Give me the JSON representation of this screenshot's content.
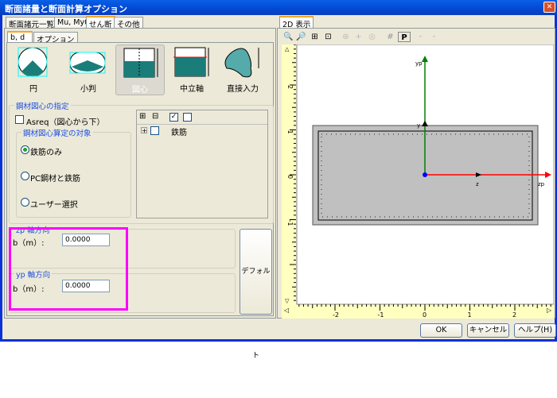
{
  "title": "断面諸量と断面計算オプション",
  "tabs": [
    "断面諸元一覧",
    "Mu, My0",
    "せん断",
    "その他"
  ],
  "subtabs": [
    "b, d",
    "オプション"
  ],
  "shape_buttons": [
    {
      "label": "円"
    },
    {
      "label": "小判"
    },
    {
      "label": "図心",
      "selected": true
    },
    {
      "label": "中立軸"
    },
    {
      "label": "直接入力"
    }
  ],
  "steel_group": {
    "title": "鋼材図心の指定",
    "asreq_label": "Asreq（図心から下）",
    "asreq_checked": false,
    "target_group": {
      "title": "鋼材図心算定の対象",
      "options": [
        "鉄筋のみ",
        "PC鋼材と鉄筋",
        "ユーザー選択"
      ],
      "selected": 0
    },
    "tree": {
      "items": [
        {
          "label": "鉄筋",
          "checked": false
        }
      ]
    }
  },
  "zp_group": {
    "title": "zp 軸方向",
    "b_label": "b（m）:",
    "b_value": "0.0000"
  },
  "yp_group": {
    "title": "yp 軸方向",
    "b_label": "b（m）:",
    "b_value": "0.0000"
  },
  "default_button": "デフォルト",
  "view_tab": "2D 表示",
  "view": {
    "x_ticks": [
      "-2",
      "-1",
      "0",
      "1",
      "2"
    ],
    "y_ticks": [
      "2",
      "1",
      "0",
      "-1"
    ],
    "axis_labels": {
      "yp": "yp",
      "zp": "zp",
      "y": "y",
      "z": "z"
    },
    "colors": {
      "yp": "#008000",
      "zp": "#ff0000",
      "origin": "#0000ff",
      "section": "#c0c0c0"
    }
  },
  "buttons": {
    "ok": "OK",
    "cancel": "キャンセル",
    "help": "ヘルプ(H)"
  },
  "highlight_color": "#ff00ff"
}
